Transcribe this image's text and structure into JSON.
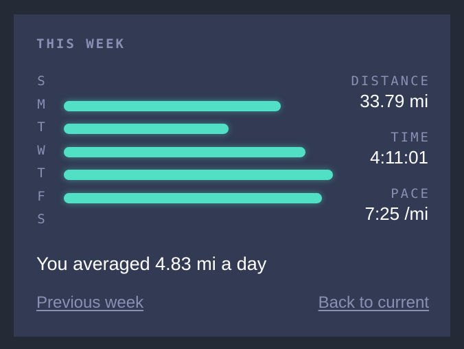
{
  "card": {
    "title": "THIS WEEK",
    "summary": "You averaged 4.83 mi a day",
    "links": {
      "previous": "Previous week",
      "current": "Back to current"
    }
  },
  "accent_color": "#51e0c6",
  "max_value": 9.8,
  "days": [
    {
      "letter": "S",
      "value": 0
    },
    {
      "letter": "M",
      "value": 7.9
    },
    {
      "letter": "T",
      "value": 6.0
    },
    {
      "letter": "W",
      "value": 8.8
    },
    {
      "letter": "T",
      "value": 9.8
    },
    {
      "letter": "F",
      "value": 9.4
    },
    {
      "letter": "S",
      "value": 0
    }
  ],
  "stats": {
    "distance": {
      "label": "DISTANCE",
      "value": "33.79 mi"
    },
    "time": {
      "label": "TIME",
      "value": "4:11:01"
    },
    "pace": {
      "label": "PACE",
      "value": "7:25 /mi"
    }
  }
}
